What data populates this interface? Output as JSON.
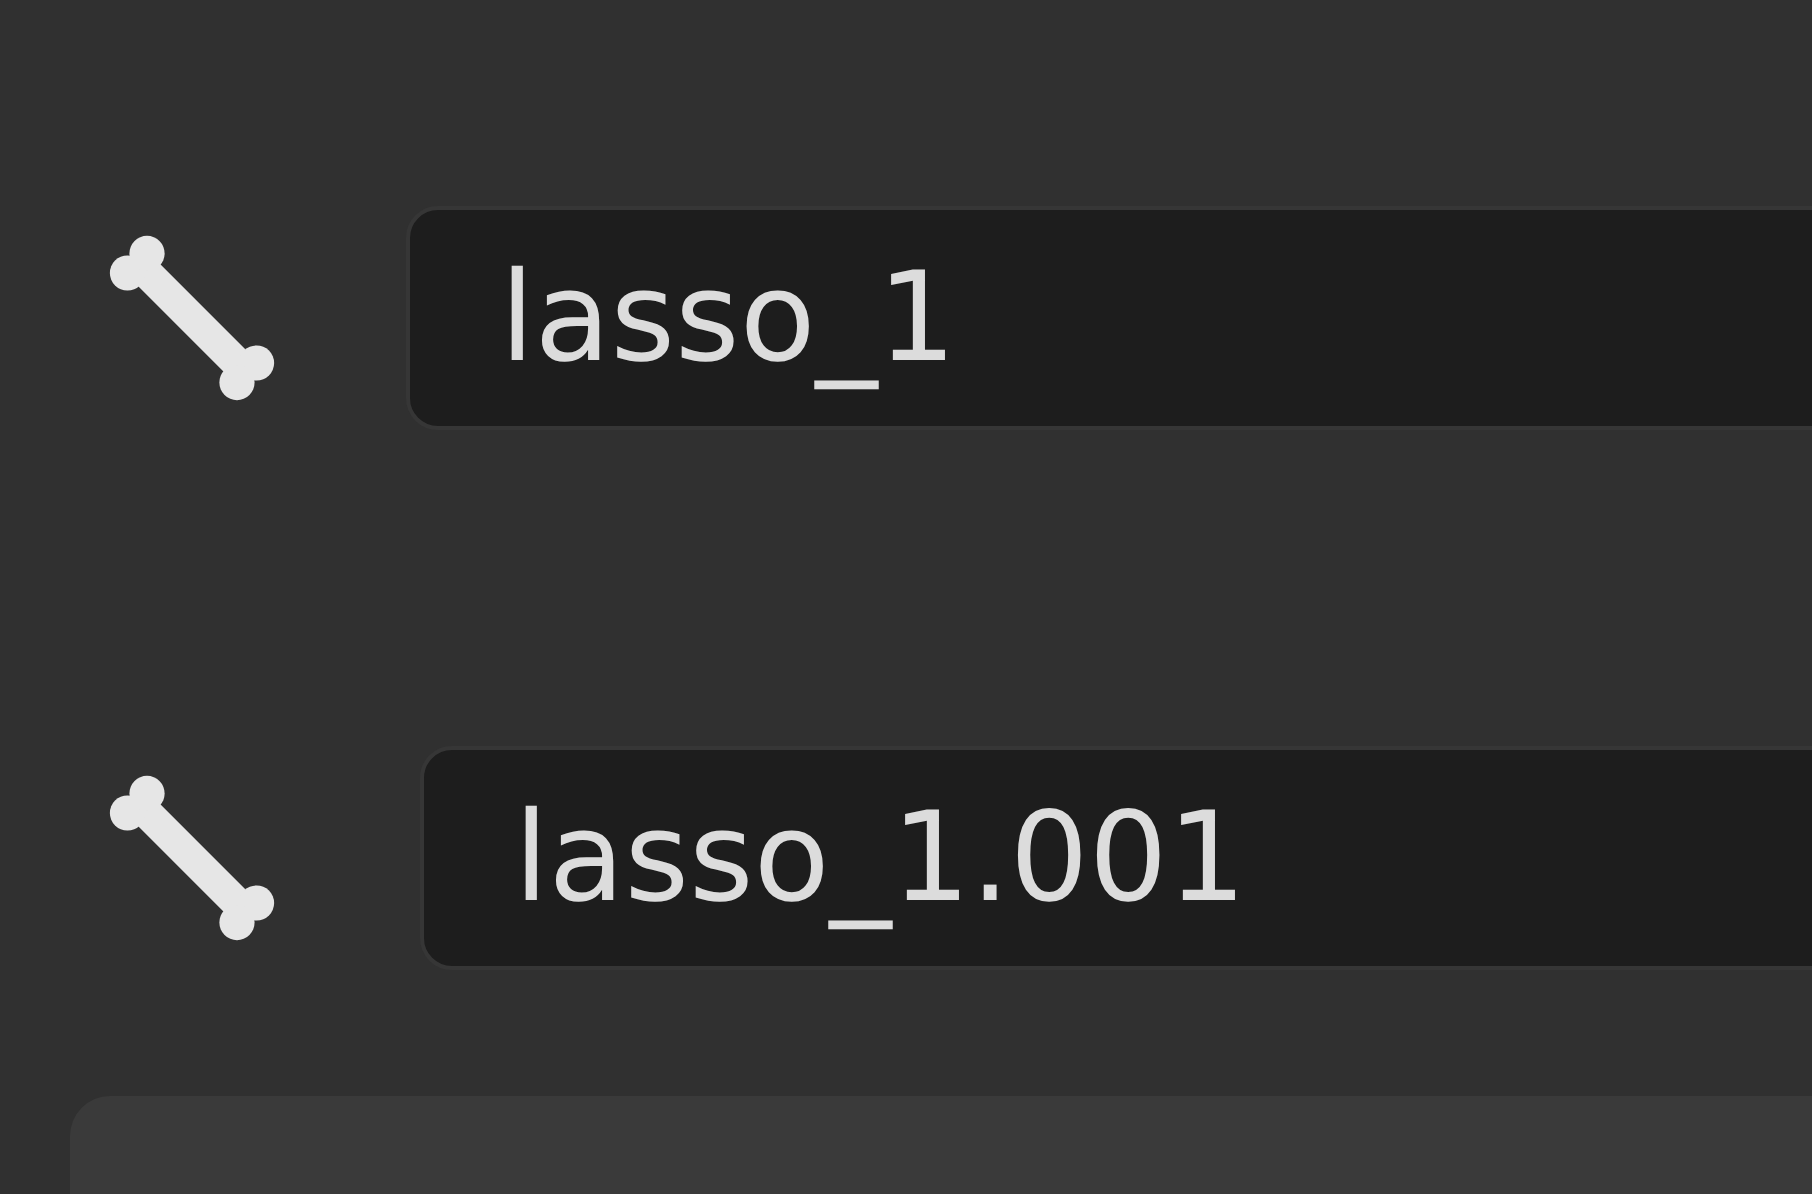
{
  "bones": [
    {
      "name": "lasso_1"
    },
    {
      "name": "lasso_1.001"
    }
  ]
}
